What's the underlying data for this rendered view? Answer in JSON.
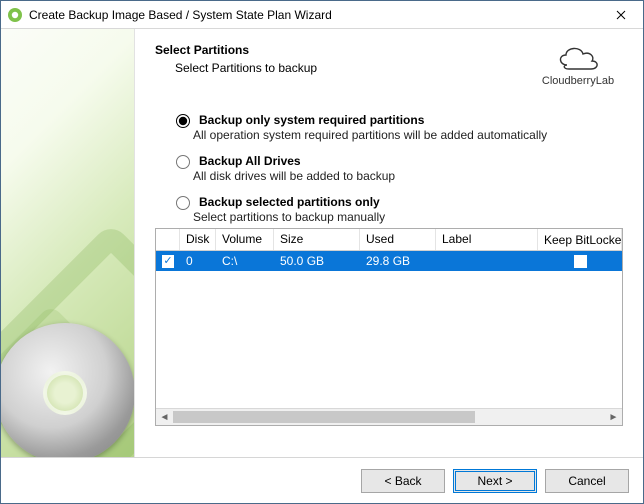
{
  "window": {
    "title": "Create Backup Image Based / System State Plan Wizard"
  },
  "brand": {
    "name": "CloudberryLab"
  },
  "heading": {
    "title": "Select Partitions",
    "subtitle": "Select Partitions to backup"
  },
  "options": [
    {
      "id": "opt-system",
      "label": "Backup only system required partitions",
      "desc": "All operation system required partitions will be added automatically",
      "selected": true
    },
    {
      "id": "opt-all",
      "label": "Backup All Drives",
      "desc": "All disk drives will be added to backup",
      "selected": false
    },
    {
      "id": "opt-selected",
      "label": "Backup selected partitions only",
      "desc": "Select partitions to backup manually",
      "selected": false
    }
  ],
  "grid": {
    "columns": [
      "",
      "Disk",
      "Volume",
      "Size",
      "Used",
      "Label",
      "Keep BitLocker"
    ],
    "rows": [
      {
        "checked": true,
        "disk": "0",
        "volume": "C:\\",
        "size": "50.0 GB",
        "used": "29.8 GB",
        "label": "",
        "keep": false,
        "selected": true
      }
    ]
  },
  "buttons": {
    "back": "< Back",
    "next": "Next >",
    "cancel": "Cancel"
  }
}
